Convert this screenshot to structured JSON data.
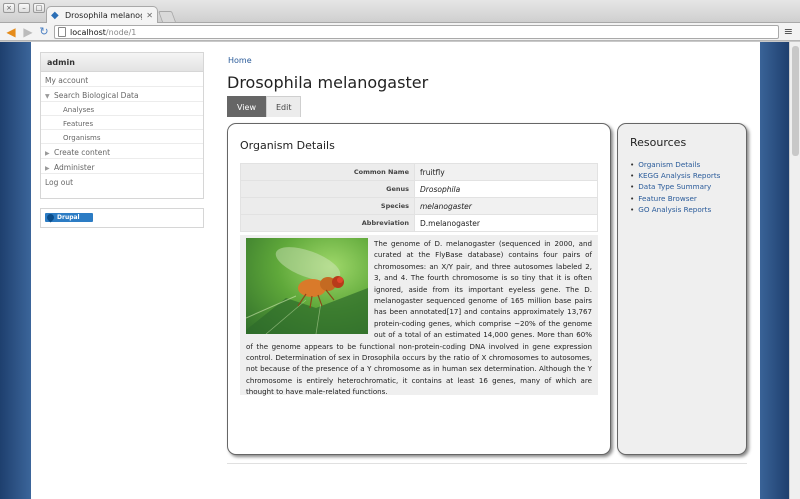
{
  "browser": {
    "tab_title": "Drosophila melanogaste",
    "url_host": "localhost",
    "url_path": "/node/1"
  },
  "sidebar": {
    "user_block_title": "admin",
    "menu": [
      {
        "label": "My account",
        "level": 0
      },
      {
        "label": "Search Biological Data",
        "level": 0,
        "expanded": true
      },
      {
        "label": "Analyses",
        "level": 1
      },
      {
        "label": "Features",
        "level": 1
      },
      {
        "label": "Organisms",
        "level": 1
      },
      {
        "label": "Create content",
        "level": 0,
        "collapsed": true
      },
      {
        "label": "Administer",
        "level": 0,
        "collapsed": true
      },
      {
        "label": "Log out",
        "level": 0
      }
    ],
    "powered_by": "Drupal"
  },
  "main": {
    "breadcrumb": "Home",
    "title": "Drosophila melanogaster",
    "tabs": [
      {
        "label": "View",
        "active": true
      },
      {
        "label": "Edit",
        "active": false
      }
    ],
    "details": {
      "heading": "Organism Details",
      "rows": [
        {
          "label": "Common Name",
          "value": "fruitfly"
        },
        {
          "label": "Genus",
          "value": "Drosophila"
        },
        {
          "label": "Species",
          "value": "melanogaster"
        },
        {
          "label": "Abbreviation",
          "value": "D.melanogaster"
        }
      ],
      "description": "The genome of D. melanogaster (sequenced in 2000, and curated at the FlyBase database) contains four pairs of chromosomes: an X/Y pair, and three autosomes labeled 2, 3, and 4. The fourth chromosome is so tiny that it is often ignored, aside from its important eyeless gene. The D. melanogaster sequenced genome of 165 million base pairs has been annotated[17] and contains approximately 13,767 protein-coding genes, which comprise ~20% of the genome out of a total of an estimated 14,000 genes. More than 60% of the genome appears to be functional non-protein-coding DNA involved in gene expression control. Determination of sex in Drosophila occurs by the ratio of X chromosomes to autosomes, not because of the presence of a Y chromosome as in human sex determination. Although the Y chromosome is entirely heterochromatic, it contains at least 16 genes, many of which are thought to have male-related functions."
    },
    "resources": {
      "heading": "Resources",
      "links": [
        "Organism Details",
        "KEGG Analysis Reports",
        "Data Type Summary",
        "Feature Browser",
        "GO Analysis Reports"
      ]
    }
  },
  "colors": {
    "link": "#2a5b9a",
    "active_tab": "#666666",
    "background": "#3c669b"
  }
}
